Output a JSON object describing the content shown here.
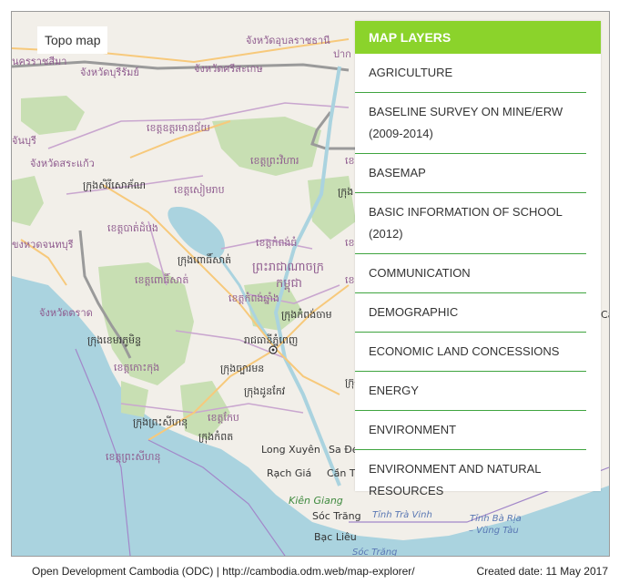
{
  "map": {
    "topo_label": "Topo map",
    "place_labels": {
      "l1": "จังหวัดอุบลราชธานี",
      "l2": "นครราชสีมา",
      "l3": "จังหวัดบุรีรัมย์",
      "l4": "จังหวัดศรีสะเกษ",
      "l5": "ខេត្តឧត្ដរមានជ័យ",
      "l6": "จันบุรี",
      "l7": "จังหวัดสระแก้ว",
      "l8": "ក្រុងសិរីសោភ័ណ",
      "l9": "ខេត្តព្រះវិហារ",
      "l10": "ខេត្តសៀមរាប",
      "l11": "ខេត្តបាត់ដំបង",
      "l12": "ขงหวดจนทบุรี",
      "l13": "ខេត្តកំពង់ធំ",
      "l14": "ក្រុងពោធិ៍សាត់",
      "l15": "ខេត្តពោធិ៍សាត់",
      "l16": "ព្រះរាជាណាចក្រ",
      "l17": "កម្ពុជា",
      "l18": "ខេត្តកំពង់ឆ្នាំង",
      "l19": "ក្រុងកំពង់ចាម",
      "l20": "จังหวัดตราด",
      "l21": "ក្រុងខេមរភូមិន្ទ",
      "l22": "រាជធានីភ្នំពេញ",
      "l23": "ខេត្តកោះកុង",
      "l24": "ក្រុងច្បារមន",
      "l25": "ក្រុងដូនកែវ",
      "l26": "ក្រុងព្រះសីហនុ",
      "l27": "ខេត្តកែប",
      "l28": "ក្រុងកំពត",
      "l29": "ខេត្តព្រះសីហនុ",
      "l30": "Long Xuyên",
      "l31": "Sa Đéc",
      "l32": "Rạch Giá",
      "l33": "Cần Thơ",
      "l34": "Kiên Giang",
      "l35": "Sóc Trăng",
      "l36": "Tỉnh Trà Vinh",
      "l37": "Bạc Liêu",
      "l38": "Tỉnh Bà Rịa",
      "l39": "– Vũng Tàu",
      "l40": "Sóc Trăng",
      "l41": "ปาก",
      "l42": "ក្រុង",
      "l43": "ខេត្ត",
      "l44": "ខេត្ត",
      "l45": "ខេត្ត",
      "l46": "ក្រុង",
      "l47": "Ca"
    }
  },
  "layers_panel": {
    "title": "MAP LAYERS",
    "items": [
      "AGRICULTURE",
      "BASELINE SURVEY ON MINE/ERW (2009-2014)",
      "BASEMAP",
      "BASIC INFORMATION OF SCHOOL (2012)",
      "COMMUNICATION",
      "DEMOGRAPHIC",
      "ECONOMIC LAND CONCESSIONS",
      "ENERGY",
      "ENVIRONMENT",
      "ENVIRONMENT AND NATURAL RESOURCES"
    ]
  },
  "footer": {
    "credit": "Open Development Cambodia (ODC) | http://cambodia.odm.web/map-explorer/",
    "created": "Created date: 11 May 2017"
  },
  "colors": {
    "accent": "#8bd32b",
    "divider": "#3fa43f",
    "land": "#f2efe9",
    "water": "#aad3df",
    "forest": "#c8dfb3"
  }
}
